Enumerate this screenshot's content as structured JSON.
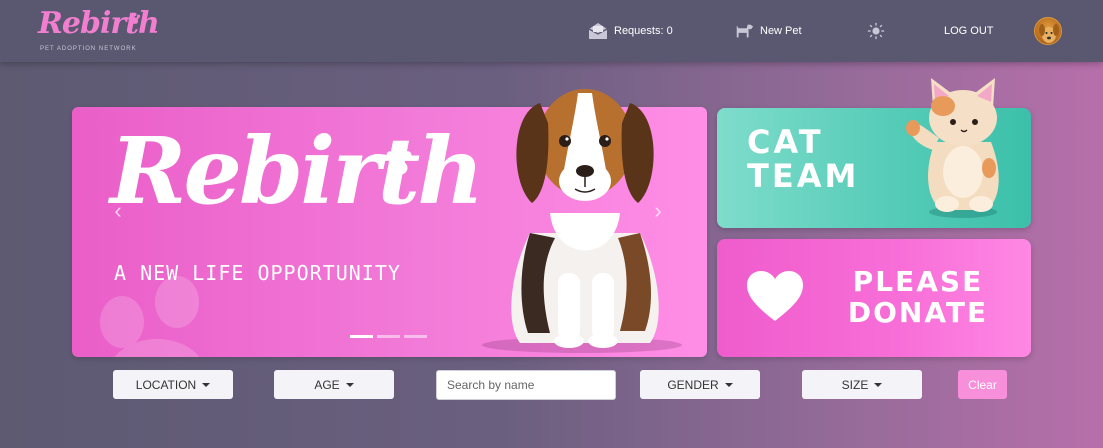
{
  "brand": {
    "logo_text": "Rebirth",
    "tagline": "PET ADOPTION NETWORK",
    "color": "#f27ed0"
  },
  "nav": {
    "requests_label": "Requests: 0",
    "requests_icon": "mail-open-icon",
    "new_pet_label": "New Pet",
    "new_pet_icon": "dog-icon",
    "theme_icon": "sun-icon",
    "logout_label": "LOG OUT",
    "avatar_icon": "user-avatar"
  },
  "hero": {
    "title": "Rebirth",
    "subtitle": "A NEW LIFE OPPORTUNITY",
    "prev_icon": "chevron-left-icon",
    "next_icon": "chevron-right-icon",
    "prev_glyph": "‹",
    "next_glyph": "›",
    "slides_total": 3,
    "active_slide": 1,
    "background_color": "#f27ad8"
  },
  "cards": {
    "cat_team": {
      "line1": "CAT",
      "line2": "TEAM",
      "color": "#56ccb8"
    },
    "donate": {
      "line1": "PLEASE",
      "line2": "DONATE",
      "icon": "heart-icon",
      "color": "#f86fd8"
    }
  },
  "filters": {
    "location_label": "LOCATION",
    "age_label": "AGE",
    "search_placeholder": "Search by name",
    "search_value": "",
    "gender_label": "GENDER",
    "size_label": "SIZE",
    "clear_label": "Clear",
    "clear_color": "#f78fda"
  }
}
